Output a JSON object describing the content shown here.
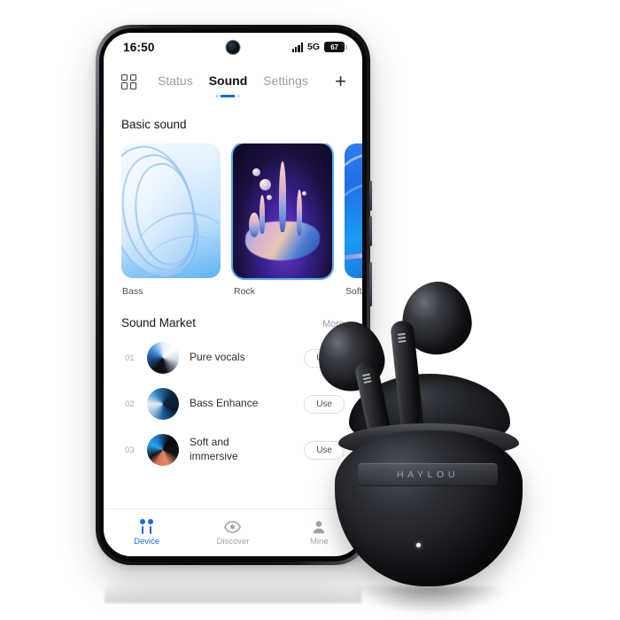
{
  "status_bar": {
    "time": "16:50",
    "network_type": "5G",
    "battery_level": "67",
    "signal_icon": "signal-bars-icon",
    "camera_icon": "front-camera-punch-hole"
  },
  "top_nav": {
    "grid_icon": "grid-menu-icon",
    "add_icon": "plus-icon",
    "add_label": "+",
    "tabs": [
      {
        "label": "Status",
        "active": false
      },
      {
        "label": "Sound",
        "active": true
      },
      {
        "label": "Settings",
        "active": false
      }
    ]
  },
  "basic_sound": {
    "title": "Basic sound",
    "presets": [
      {
        "label": "Bass",
        "selected": false,
        "art": "blue-glass-ribbons"
      },
      {
        "label": "Rock",
        "selected": true,
        "art": "purple-liquid-splash"
      },
      {
        "label": "Soft",
        "selected": false,
        "art": "vivid-blue-swoosh"
      }
    ]
  },
  "sound_market": {
    "title": "Sound Market",
    "more_label": "More",
    "use_label": "Use",
    "items": [
      {
        "index": "01",
        "name": "Pure vocals",
        "thumb": "thumb-pure"
      },
      {
        "index": "02",
        "name": "Bass Enhance",
        "thumb": "thumb-bass"
      },
      {
        "index": "03",
        "name": "Soft and\nimmersive",
        "thumb": "thumb-soft"
      }
    ]
  },
  "bottom_nav": {
    "items": [
      {
        "label": "Device",
        "icon": "earbuds-icon",
        "active": true
      },
      {
        "label": "Discover",
        "icon": "eye-icon",
        "active": false
      },
      {
        "label": "Mine",
        "icon": "person-icon",
        "active": false
      }
    ]
  },
  "product": {
    "brand": "HAYLOU",
    "description": "black-wireless-earbuds-with-charging-case"
  },
  "colors": {
    "accent": "#1769e0",
    "tab_active_text": "#111111",
    "tab_inactive_text": "#9a9da3",
    "screen_background": "#ffffff",
    "page_background": "#ffffff",
    "card_selected_outline": "#5aa9f5",
    "product_body": "#17181c"
  }
}
